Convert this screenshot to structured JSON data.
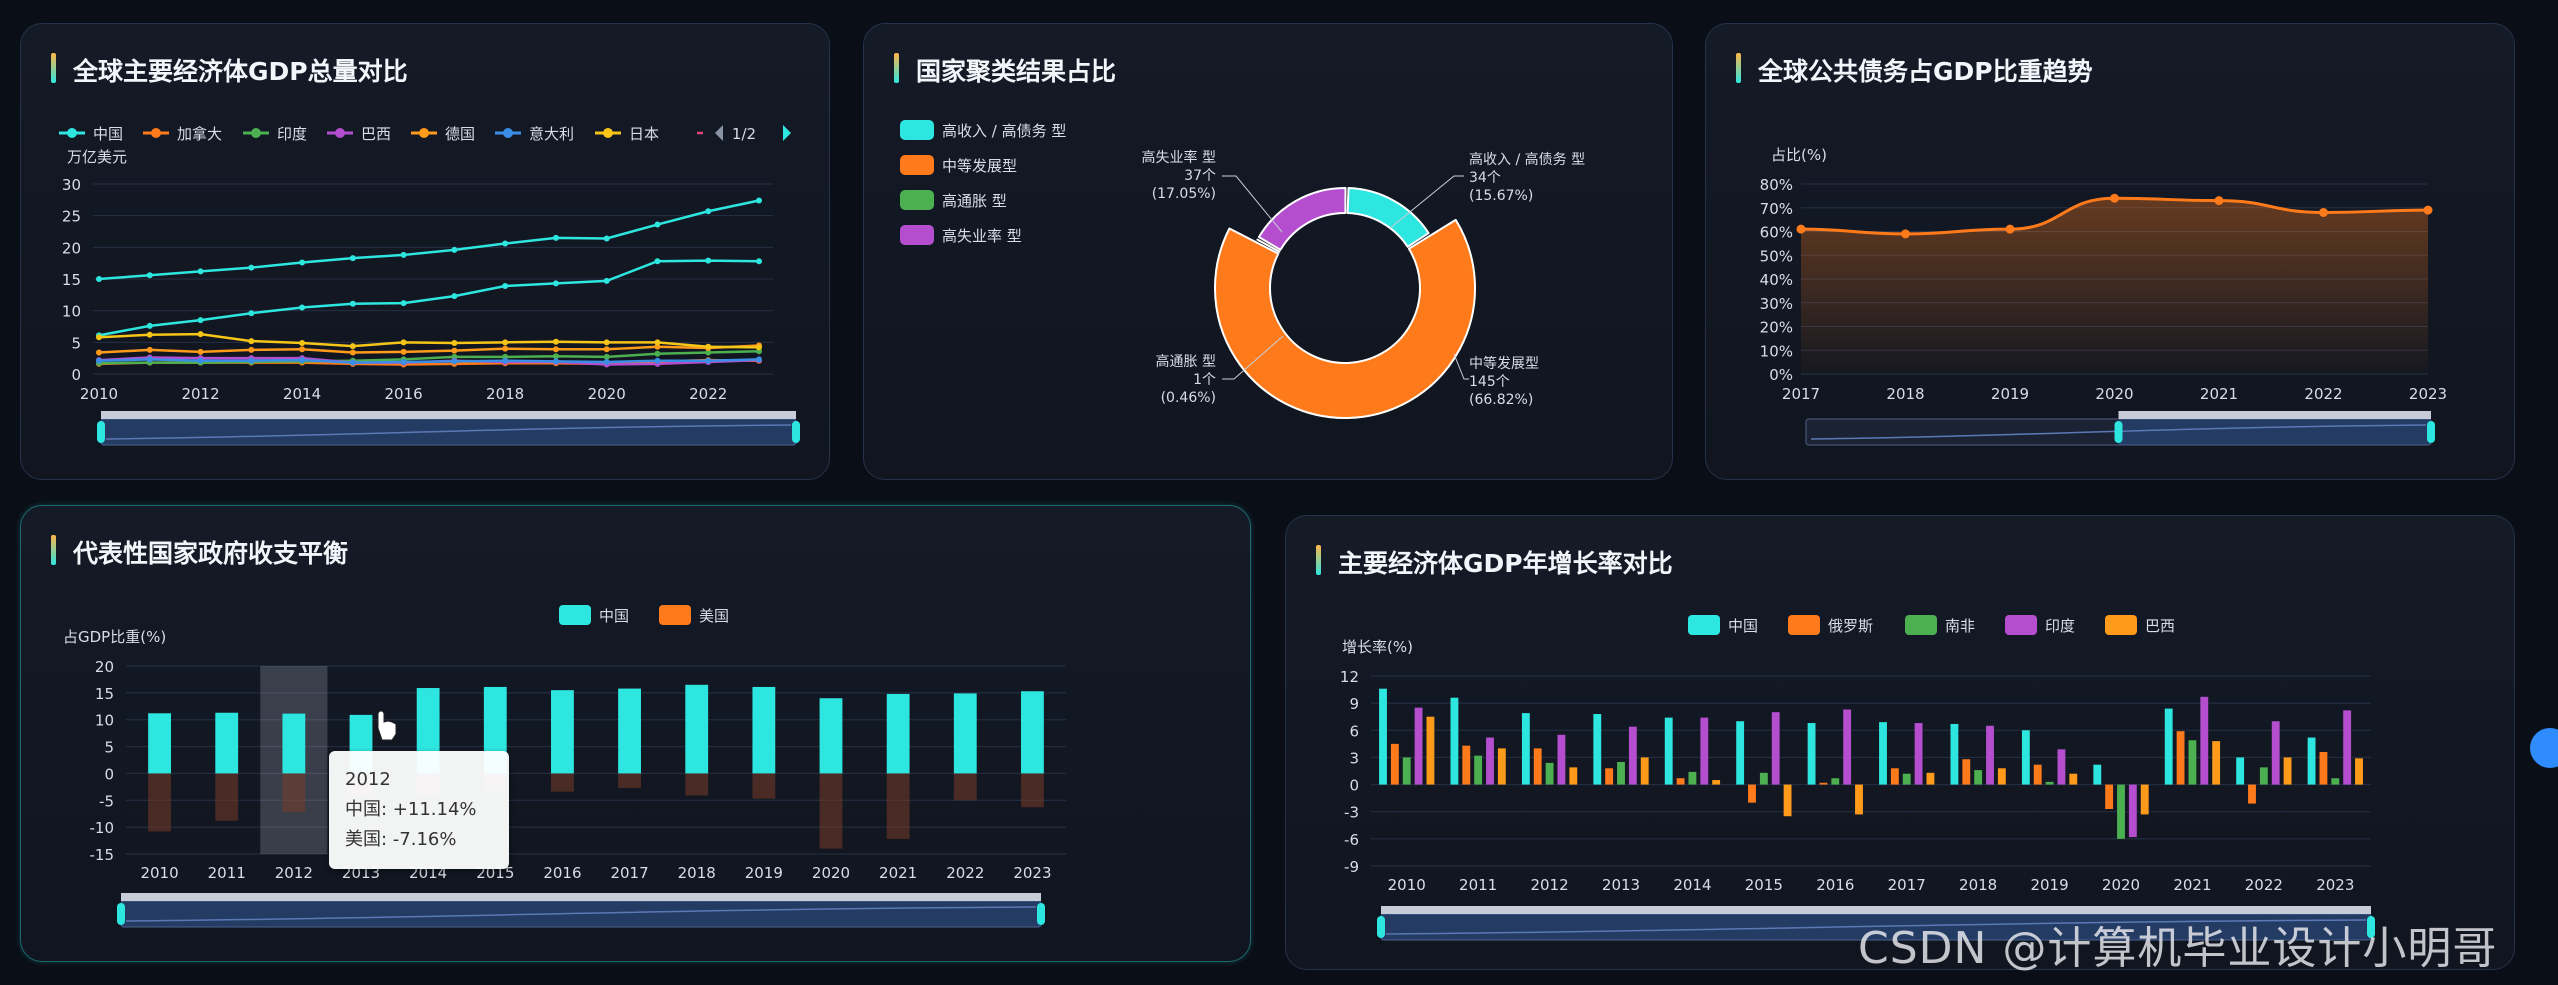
{
  "panels": {
    "p1": {
      "title": "全球主要经济体GDP总量对比"
    },
    "p2": {
      "title": "国家聚类结果占比"
    },
    "p3": {
      "title": "全球公共债务占GDP比重趋势"
    },
    "p4": {
      "title": "代表性国家政府收支平衡"
    },
    "p5": {
      "title": "主要经济体GDP年增长率对比"
    }
  },
  "charts": {
    "gdp": {
      "type": "line",
      "ylabel": "万亿美元",
      "ylim": [
        0,
        30
      ],
      "yticks": [
        0,
        5,
        10,
        15,
        20,
        25,
        30
      ],
      "x": [
        2010,
        2011,
        2012,
        2013,
        2014,
        2015,
        2016,
        2017,
        2018,
        2019,
        2020,
        2021,
        2022,
        2023
      ],
      "xticks": [
        2010,
        2012,
        2014,
        2016,
        2018,
        2020,
        2022
      ],
      "legend_page": "1/2",
      "series": [
        {
          "name": "中国",
          "color": "#2ee6e0",
          "values": [
            6.1,
            7.6,
            8.5,
            9.6,
            10.5,
            11.1,
            11.2,
            12.3,
            13.9,
            14.3,
            14.7,
            17.8,
            17.9,
            17.8
          ]
        },
        {
          "name": "加拿大",
          "color": "#ff7a1a",
          "values": [
            1.6,
            1.8,
            1.8,
            1.8,
            1.8,
            1.6,
            1.5,
            1.6,
            1.7,
            1.7,
            1.6,
            2.0,
            2.2,
            2.1
          ]
        },
        {
          "name": "印度",
          "color": "#4caf50",
          "values": [
            1.7,
            1.8,
            1.8,
            1.9,
            2.0,
            2.1,
            2.3,
            2.7,
            2.7,
            2.8,
            2.7,
            3.2,
            3.4,
            3.6
          ]
        },
        {
          "name": "巴西",
          "color": "#b44ecf",
          "values": [
            2.2,
            2.6,
            2.5,
            2.5,
            2.5,
            1.8,
            1.8,
            2.1,
            1.9,
            1.9,
            1.5,
            1.6,
            1.9,
            2.2
          ]
        },
        {
          "name": "德国",
          "color": "#ff9a1a",
          "values": [
            3.4,
            3.8,
            3.5,
            3.8,
            3.9,
            3.4,
            3.5,
            3.7,
            4.0,
            3.9,
            3.9,
            4.3,
            4.1,
            4.5
          ]
        },
        {
          "name": "意大利",
          "color": "#3a8ee6",
          "values": [
            2.1,
            2.3,
            2.1,
            2.1,
            2.2,
            1.8,
            1.9,
            2.0,
            2.1,
            2.0,
            1.9,
            2.1,
            2.1,
            2.3
          ]
        },
        {
          "name": "日本",
          "color": "#f5c518",
          "values": [
            5.8,
            6.2,
            6.3,
            5.2,
            4.9,
            4.4,
            5.0,
            4.9,
            5.0,
            5.1,
            5.0,
            5.0,
            4.3,
            4.2
          ]
        },
        {
          "name": "",
          "color": "#2ee6e0",
          "values": [
            15.0,
            15.6,
            16.2,
            16.8,
            17.6,
            18.3,
            18.8,
            19.6,
            20.6,
            21.5,
            21.4,
            23.6,
            25.7,
            27.4
          ]
        }
      ]
    },
    "cluster": {
      "type": "pie",
      "slices": [
        {
          "name": "高收入 / 高债务 型",
          "label_lines": [
            "高收入 / 高债务 型",
            "34个",
            "(15.67%)"
          ],
          "value": 34,
          "color": "#2ee6e0"
        },
        {
          "name": "中等发展型",
          "label_lines": [
            "中等发展型",
            "145个",
            "(66.82%)"
          ],
          "value": 145,
          "color": "#ff7a1a"
        },
        {
          "name": "高通胀 型",
          "label_lines": [
            "高通胀 型",
            "1个",
            "(0.46%)"
          ],
          "value": 1,
          "color": "#4caf50"
        },
        {
          "name": "高失业率 型",
          "label_lines": [
            "高失业率 型",
            "37个",
            "(17.05%)"
          ],
          "value": 37,
          "color": "#b44ecf"
        }
      ]
    },
    "debt": {
      "type": "area",
      "ylabel": "占比(%)",
      "ylim": [
        0,
        80
      ],
      "yticks": [
        "0%",
        "10%",
        "20%",
        "30%",
        "40%",
        "50%",
        "60%",
        "70%",
        "80%"
      ],
      "x": [
        "2017",
        "2018",
        "2019",
        "2020",
        "2021",
        "2022",
        "2023"
      ],
      "values": [
        61,
        59,
        61,
        74,
        73,
        68,
        69
      ],
      "color": "#ff7a1a"
    },
    "balance": {
      "type": "bar",
      "ylabel": "占GDP比重(%)",
      "ylim": [
        -15,
        20
      ],
      "yticks": [
        -15,
        -10,
        -5,
        0,
        5,
        10,
        15,
        20
      ],
      "categories": [
        "2010",
        "2011",
        "2012",
        "2013",
        "2014",
        "2015",
        "2016",
        "2017",
        "2018",
        "2019",
        "2020",
        "2021",
        "2022",
        "2023"
      ],
      "series": [
        {
          "name": "中国",
          "color": "#2ee6e0",
          "values": [
            11.2,
            11.3,
            11.14,
            10.9,
            15.9,
            16.1,
            15.5,
            15.8,
            16.5,
            16.1,
            14.0,
            14.8,
            14.9,
            15.3
          ]
        },
        {
          "name": "美国",
          "color": "#ff7a1a",
          "values": [
            -10.8,
            -8.8,
            -7.16,
            -4.1,
            -4.3,
            -3.3,
            -3.4,
            -2.7,
            -4.1,
            -4.7,
            -14.0,
            -12.2,
            -5.0,
            -6.3
          ]
        }
      ],
      "tooltip": {
        "title": "2012",
        "lines": [
          "中国: +11.14%",
          "美国: -7.16%"
        ]
      }
    },
    "growth": {
      "type": "bar",
      "ylabel": "增长率(%)",
      "ylim": [
        -9,
        12
      ],
      "yticks": [
        -9,
        -6,
        -3,
        0,
        3,
        6,
        9,
        12
      ],
      "categories": [
        "2010",
        "2011",
        "2012",
        "2013",
        "2014",
        "2015",
        "2016",
        "2017",
        "2018",
        "2019",
        "2020",
        "2021",
        "2022",
        "2023"
      ],
      "series": [
        {
          "name": "中国",
          "color": "#2ee6e0",
          "values": [
            10.6,
            9.6,
            7.9,
            7.8,
            7.4,
            7.0,
            6.8,
            6.9,
            6.7,
            6.0,
            2.2,
            8.4,
            3.0,
            5.2
          ]
        },
        {
          "name": "俄罗斯",
          "color": "#ff7a1a",
          "values": [
            4.5,
            4.3,
            4.0,
            1.8,
            0.7,
            -2.0,
            0.2,
            1.8,
            2.8,
            2.2,
            -2.7,
            5.9,
            -2.1,
            3.6
          ]
        },
        {
          "name": "南非",
          "color": "#4caf50",
          "values": [
            3.0,
            3.2,
            2.4,
            2.5,
            1.4,
            1.3,
            0.7,
            1.2,
            1.6,
            0.3,
            -6.0,
            4.9,
            1.9,
            0.7
          ]
        },
        {
          "name": "印度",
          "color": "#b44ecf",
          "values": [
            8.5,
            5.2,
            5.5,
            6.4,
            7.4,
            8.0,
            8.3,
            6.8,
            6.5,
            3.9,
            -5.8,
            9.7,
            7.0,
            8.2
          ]
        },
        {
          "name": "巴西",
          "color": "#ff9a1a",
          "values": [
            7.5,
            4.0,
            1.9,
            3.0,
            0.5,
            -3.5,
            -3.3,
            1.3,
            1.8,
            1.2,
            -3.3,
            4.8,
            3.0,
            2.9
          ]
        }
      ]
    }
  },
  "watermark": "CSDN @计算机毕业设计小明哥"
}
